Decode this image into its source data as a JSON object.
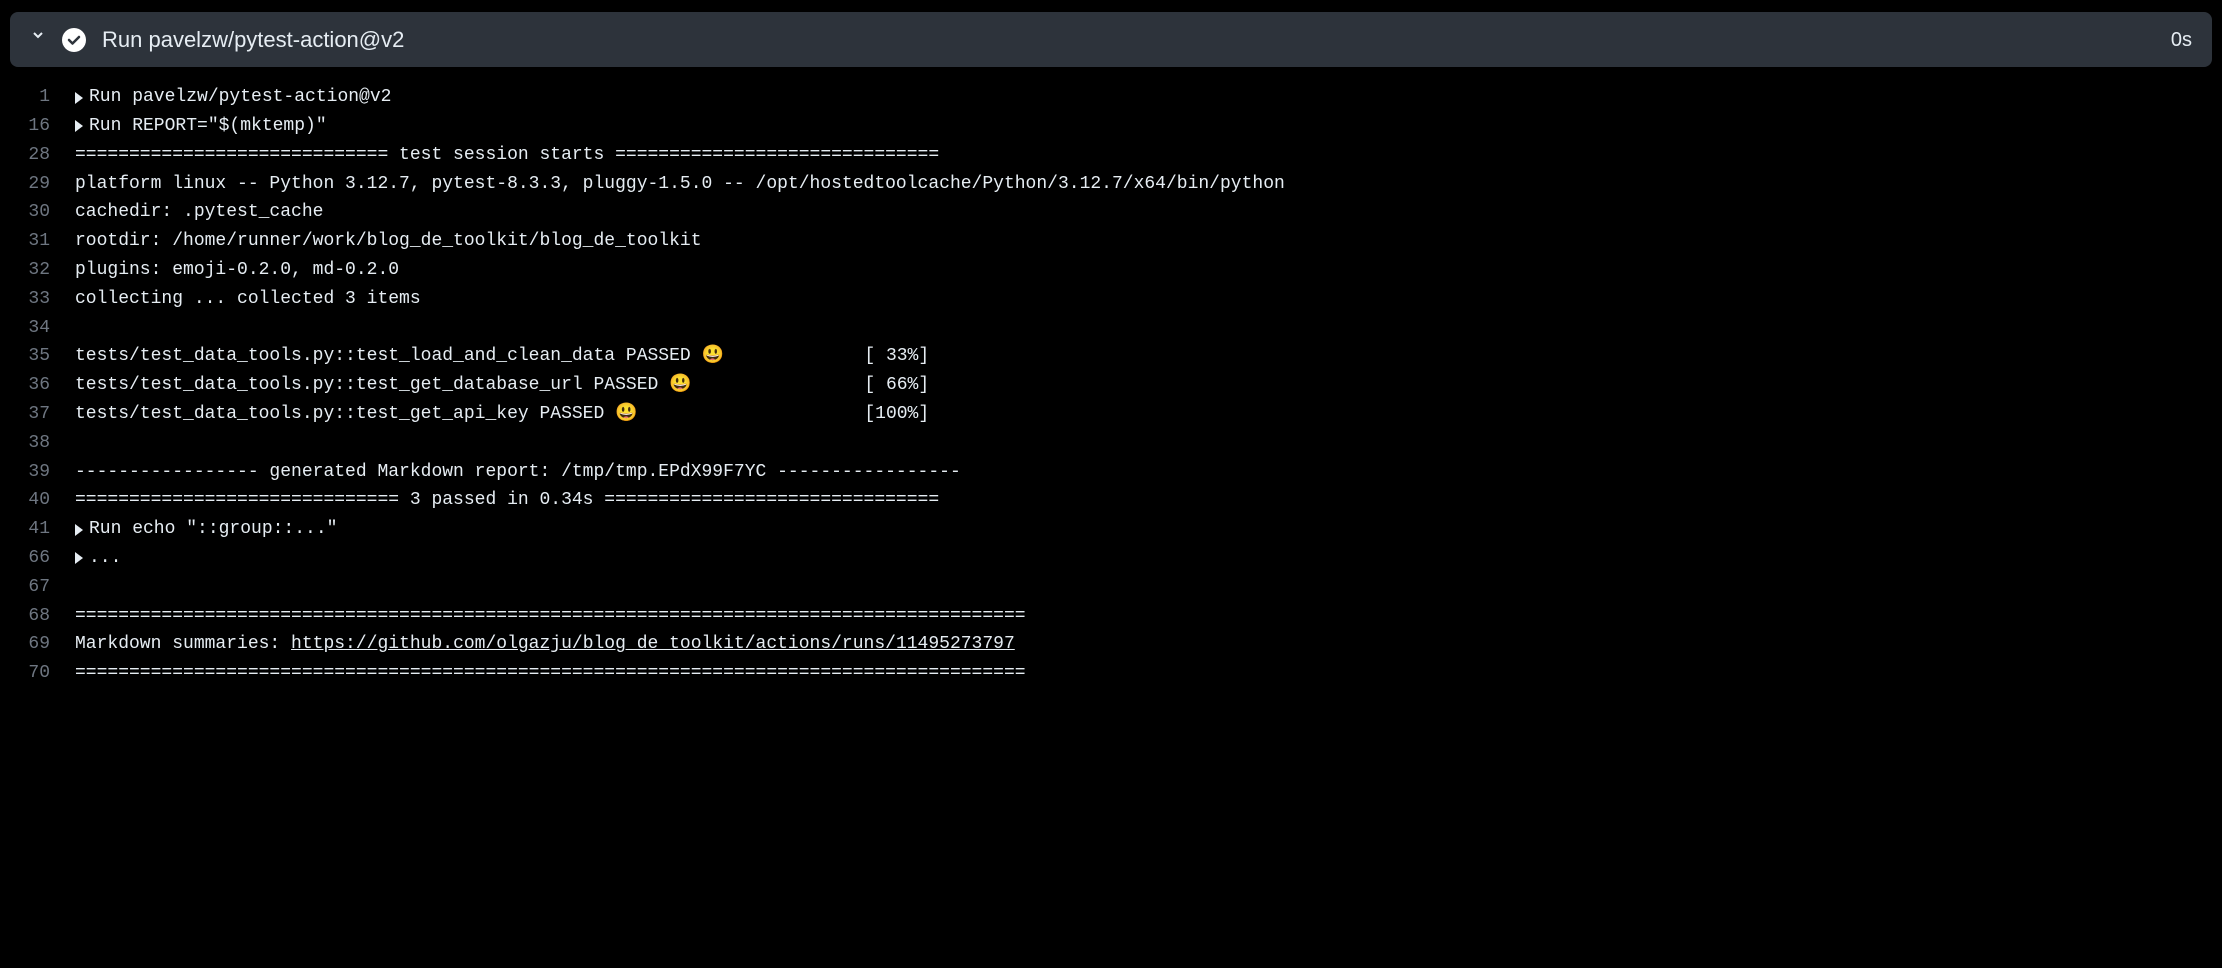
{
  "header": {
    "title": "Run pavelzw/pytest-action@v2",
    "duration": "0s"
  },
  "lines": [
    {
      "num": "1",
      "collapsible": true,
      "text": "Run pavelzw/pytest-action@v2"
    },
    {
      "num": "16",
      "collapsible": true,
      "text": "Run REPORT=\"$(mktemp)\""
    },
    {
      "num": "28",
      "text": "============================= test session starts =============================="
    },
    {
      "num": "29",
      "text": "platform linux -- Python 3.12.7, pytest-8.3.3, pluggy-1.5.0 -- /opt/hostedtoolcache/Python/3.12.7/x64/bin/python"
    },
    {
      "num": "30",
      "text": "cachedir: .pytest_cache"
    },
    {
      "num": "31",
      "text": "rootdir: /home/runner/work/blog_de_toolkit/blog_de_toolkit"
    },
    {
      "num": "32",
      "text": "plugins: emoji-0.2.0, md-0.2.0"
    },
    {
      "num": "33",
      "text": "collecting ... collected 3 items"
    },
    {
      "num": "34",
      "text": ""
    },
    {
      "num": "35",
      "text": "tests/test_data_tools.py::test_load_and_clean_data PASSED 😃             [ 33%]"
    },
    {
      "num": "36",
      "text": "tests/test_data_tools.py::test_get_database_url PASSED 😃                [ 66%]"
    },
    {
      "num": "37",
      "text": "tests/test_data_tools.py::test_get_api_key PASSED 😃                     [100%]"
    },
    {
      "num": "38",
      "text": ""
    },
    {
      "num": "39",
      "text": "----------------- generated Markdown report: /tmp/tmp.EPdX99F7YC -----------------"
    },
    {
      "num": "40",
      "text": "============================== 3 passed in 0.34s ==============================="
    },
    {
      "num": "41",
      "collapsible": true,
      "text": "Run echo \"::group::...\""
    },
    {
      "num": "66",
      "collapsible": true,
      "text": "..."
    },
    {
      "num": "67",
      "text": ""
    },
    {
      "num": "68",
      "text": "========================================================================================"
    },
    {
      "num": "69",
      "prefix": "Markdown summaries: ",
      "link": "https://github.com/olgazju/blog_de_toolkit/actions/runs/11495273797"
    },
    {
      "num": "70",
      "text": "========================================================================================"
    }
  ]
}
